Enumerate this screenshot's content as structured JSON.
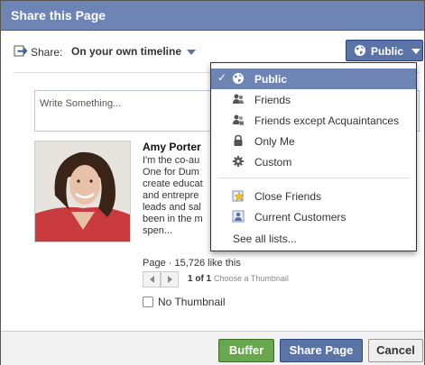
{
  "dialog": {
    "title": "Share this Page"
  },
  "share": {
    "label": "Share:",
    "target": "On your own timeline",
    "audience": "Public"
  },
  "compose": {
    "placeholder": "Write Something..."
  },
  "preview": {
    "title": "Amy Porter",
    "description": "I'm the co-au\nOne for Dum\ncreate educat\nand entrepre\nleads and sal\nbeen in the m\nspen...",
    "meta": "Page · 15,726 like this",
    "pager_count": "1 of 1",
    "choose_thumbnail": "Choose a Thumbnail",
    "no_thumbnail": "No Thumbnail"
  },
  "audience_menu": {
    "items": [
      {
        "label": "Public",
        "icon": "globe-icon",
        "selected": true
      },
      {
        "label": "Friends",
        "icon": "friends-icon"
      },
      {
        "label": "Friends except Acquaintances",
        "icon": "friends-except-icon"
      },
      {
        "label": "Only Me",
        "icon": "lock-icon"
      },
      {
        "label": "Custom",
        "icon": "gear-icon"
      }
    ],
    "lists": [
      {
        "label": "Close Friends",
        "icon": "star-list-icon"
      },
      {
        "label": "Current Customers",
        "icon": "person-list-icon"
      }
    ],
    "see_all": "See all lists...",
    "check": "✓"
  },
  "footer": {
    "buffer": "Buffer",
    "share_page": "Share Page",
    "cancel": "Cancel"
  },
  "colors": {
    "header": "#6d84b4",
    "primary": "#5b74a8",
    "buffer": "#69a74e"
  }
}
